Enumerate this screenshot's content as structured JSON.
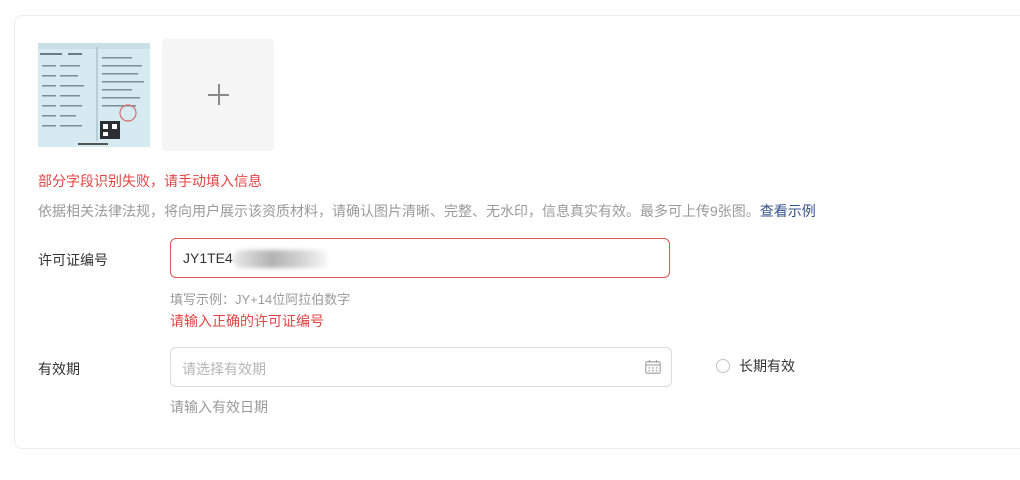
{
  "upload": {
    "thumbnail_icon": "license-document-image",
    "add_icon": "plus-icon"
  },
  "messages": {
    "recognition_error": "部分字段识别失败，请手动填入信息",
    "hint_text": "依据相关法律法规，将向用户展示该资质材料，请确认图片清晰、完整、无水印，信息真实有效。最多可上传9张图。",
    "hint_link": "查看示例"
  },
  "license": {
    "label": "许可证编号",
    "value": "JY1TE4",
    "example": "填写示例：JY+14位阿拉伯数字",
    "error": "请输入正确的许可证编号"
  },
  "validity": {
    "label": "有效期",
    "placeholder": "请选择有效期",
    "calendar_icon": "calendar-icon",
    "long_term_label": "长期有效",
    "long_term_checked": false,
    "error": "请输入有效日期"
  },
  "colors": {
    "error": "#e24444",
    "link": "#33518b",
    "input_error_border": "#e45656"
  }
}
